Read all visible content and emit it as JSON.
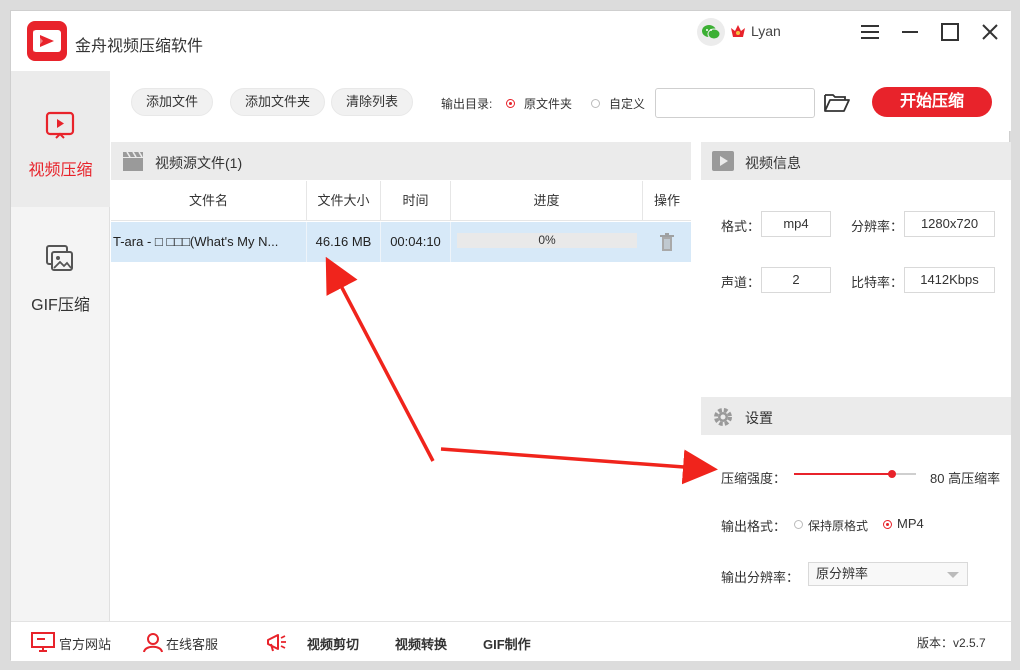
{
  "app": {
    "title": "金舟视频压缩软件",
    "user_name": "Lyan",
    "accent_color": "#e8232b"
  },
  "sidebar": {
    "items": [
      {
        "label": "视频压缩",
        "icon": "video-compress-icon",
        "active": true
      },
      {
        "label": "GIF压缩",
        "icon": "gif-compress-icon",
        "active": false
      }
    ]
  },
  "toolbar": {
    "add_file_label": "添加文件",
    "add_folder_label": "添加文件夹",
    "clear_list_label": "清除列表",
    "output_dir_label": "输出目录:",
    "radio_original_label": "原文件夹",
    "radio_custom_label": "自定义",
    "path_value": "",
    "start_label": "开始压缩"
  },
  "file_panel": {
    "header": "视频源文件(1)",
    "columns": [
      "文件名",
      "文件大小",
      "时间",
      "进度",
      "操作"
    ],
    "rows": [
      {
        "name": "T-ara - □ □□□(What's My N...",
        "size": "46.16 MB",
        "time": "00:04:10",
        "progress_text": "0%",
        "progress_fraction": 0.0
      }
    ]
  },
  "video_info": {
    "header": "视频信息",
    "format_label": "格式：",
    "format_value": "mp4",
    "resolution_label": "分辨率：",
    "resolution_value": "1280x720",
    "channel_label": "声道：",
    "channel_value": "2",
    "bitrate_label": "比特率：",
    "bitrate_value": "1412Kbps"
  },
  "settings": {
    "header": "设置",
    "strength_label": "压缩强度：",
    "strength_value": 80,
    "strength_text": "80 高压缩率",
    "output_format_label": "输出格式：",
    "format_keep_label": "保持原格式",
    "format_mp4_label": "MP4",
    "output_resolution_label": "输出分辨率：",
    "output_resolution_value": "原分辨率"
  },
  "bottom": {
    "website_label": "官方网站",
    "support_label": "在线客服",
    "video_cut_label": "视频剪切",
    "video_convert_label": "视频转换",
    "gif_make_label": "GIF制作",
    "version_text": "版本：v2.5.7"
  }
}
